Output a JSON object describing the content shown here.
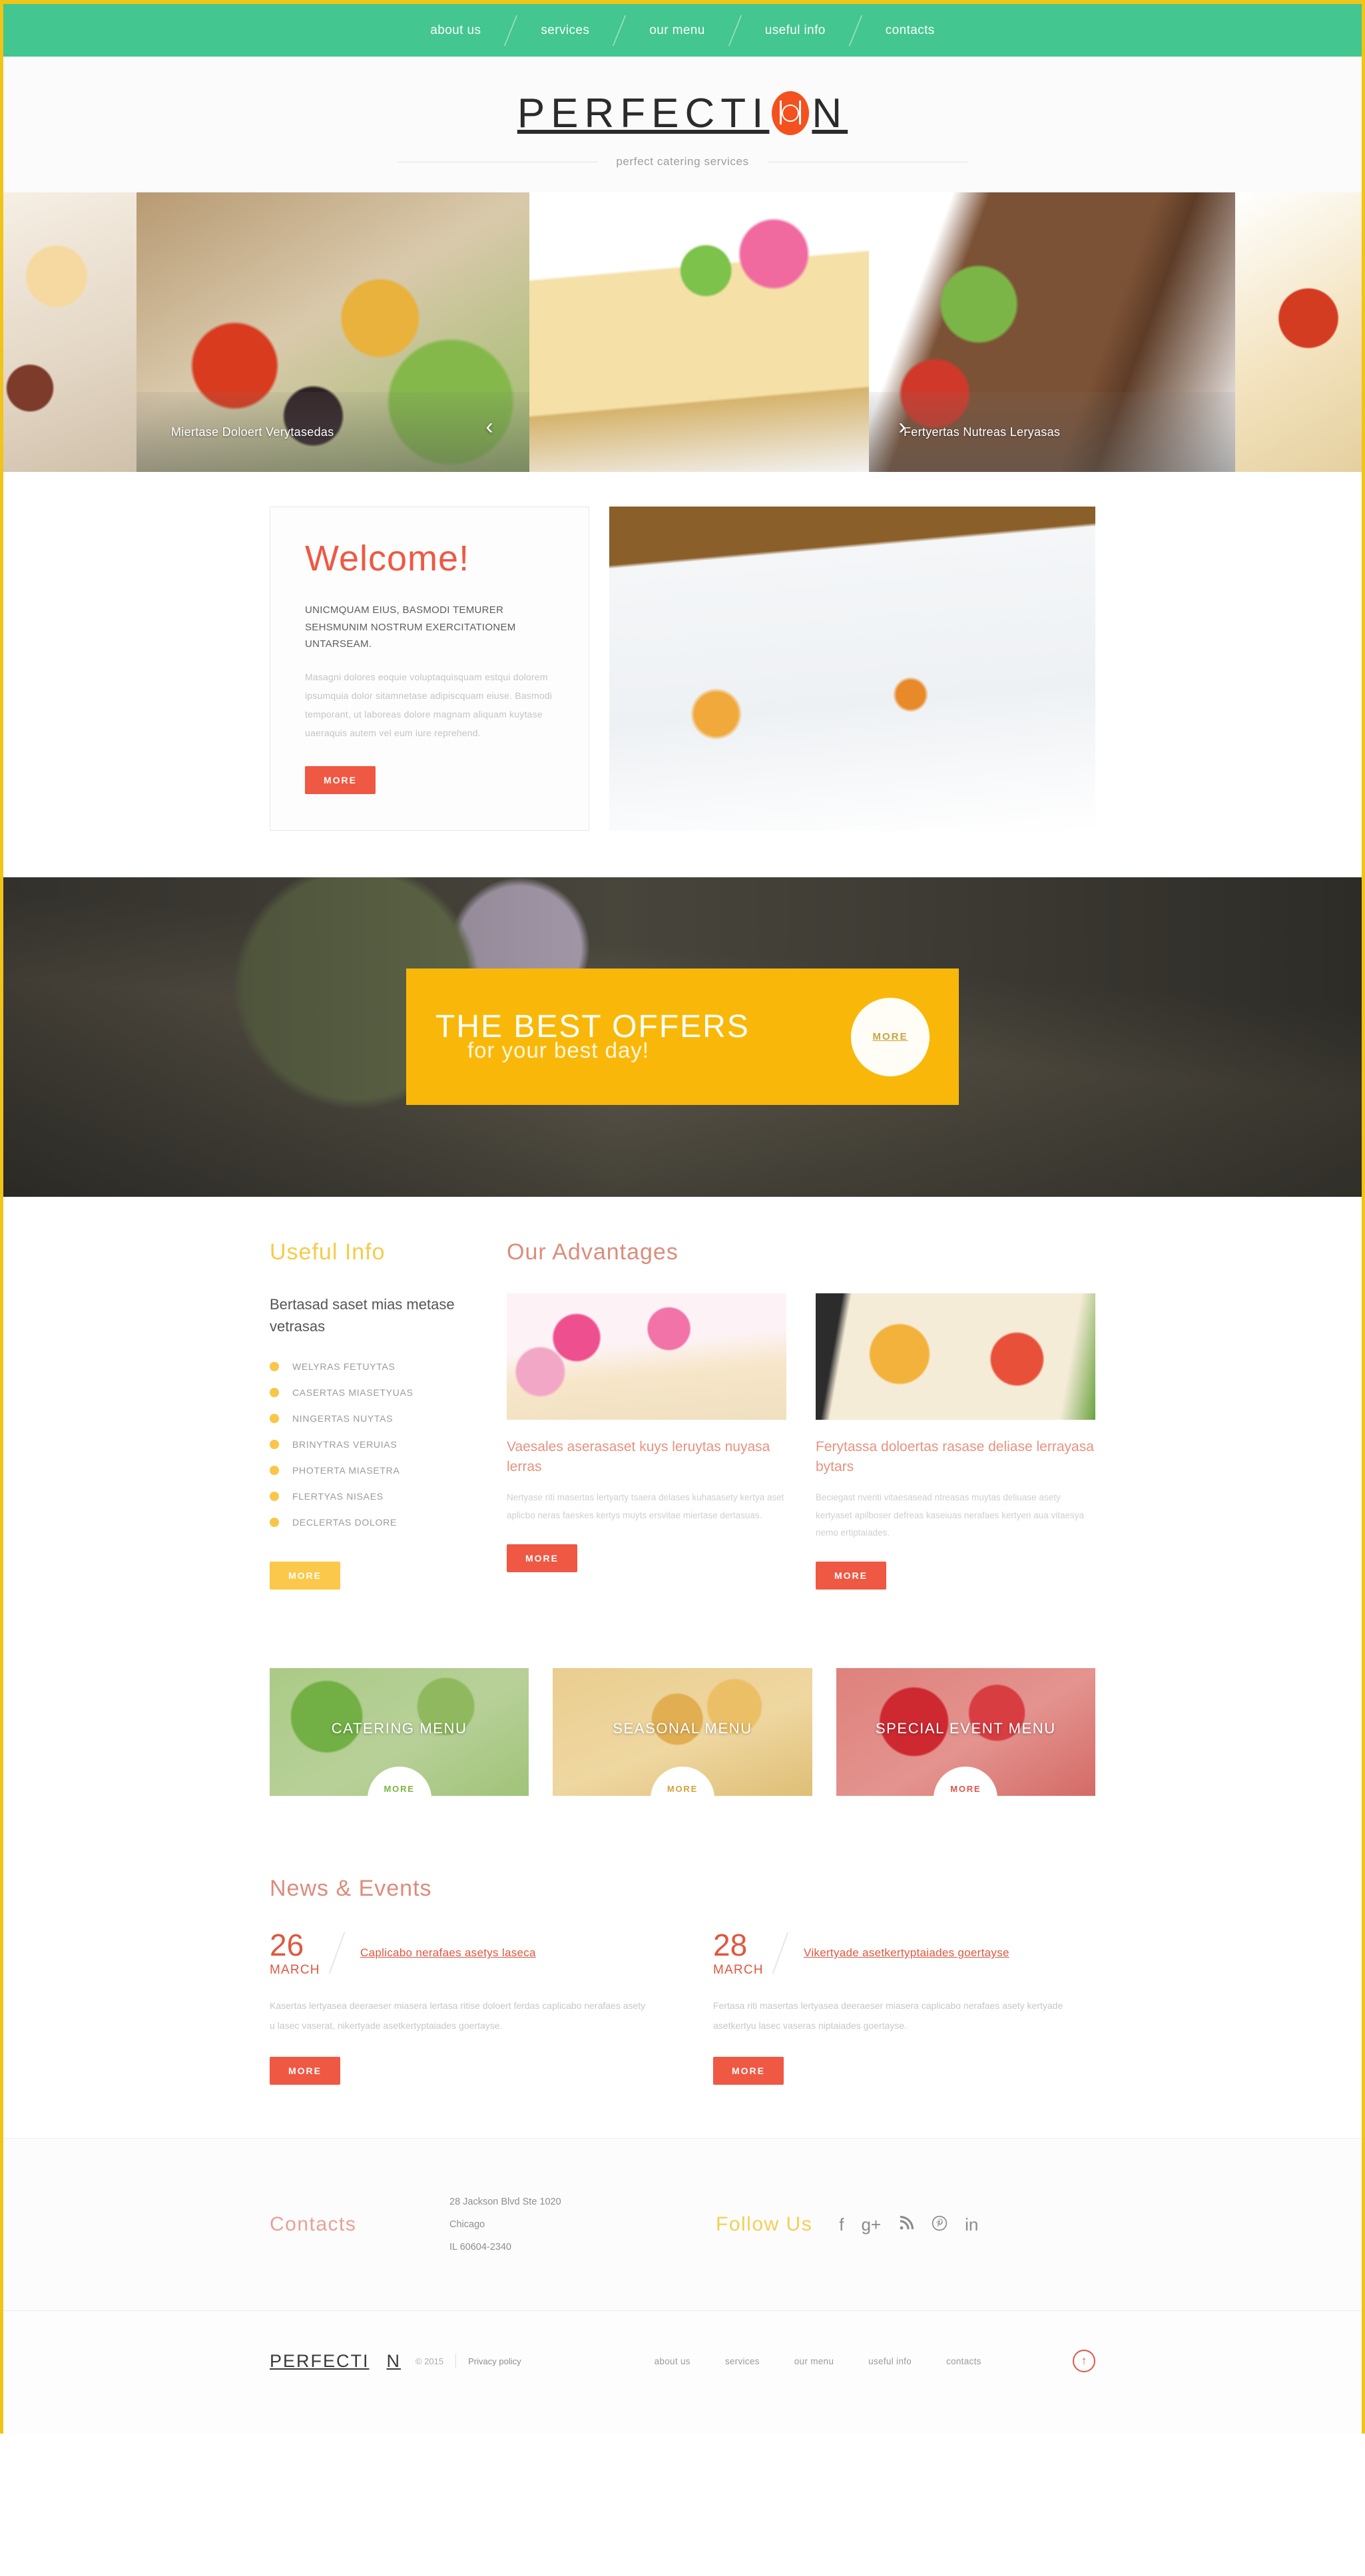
{
  "topnav": {
    "items": [
      {
        "label": "about us"
      },
      {
        "label": "services"
      },
      {
        "label": "our menu"
      },
      {
        "label": "useful info"
      },
      {
        "label": "contacts"
      }
    ]
  },
  "brand": {
    "name_before": "PERFECTI",
    "name_after": "N",
    "tagline": "perfect catering services",
    "logo_icon": "plate-fork-knife-icon",
    "accent_orange": "#f4511e"
  },
  "slider": {
    "slides": [
      {
        "caption": "",
        "photo": "octopus-dish-photo"
      },
      {
        "caption": "Miertase Doloert Verytasedas",
        "photo": "salad-skewers-photo"
      },
      {
        "caption": "",
        "photo": "cheesecake-dessert-photo"
      },
      {
        "caption": "Fertyertas Nutreas Leryasas",
        "photo": "roast-beef-photo"
      },
      {
        "caption": "",
        "photo": "pasta-photo"
      }
    ],
    "prev_icon": "chevron-left-icon",
    "next_icon": "chevron-right-icon"
  },
  "welcome": {
    "heading": "Welcome!",
    "lead": "UNICMQUAM EIUS, BASMODI TEMURER  SEHSMUNIM NOSTRUM EXERCITATIONEM UNTARSEAM.",
    "body": "Masagni dolores eoquie voluptaquisquam estqui dolorem ipsumquia dolor sitamnetase adipiscquam eiuse. Basmodi temporant, ut laboreas dolore magnam aliquam kuytase uaeraquis autem vel eum iure reprehend.",
    "more_label": "MORE",
    "image": "banquet-table-photo"
  },
  "offers": {
    "title": "THE BEST OFFERS",
    "subtitle": "for your best day!",
    "more_label": "MORE",
    "accent_yellow": "#f9b809",
    "background": "outdoor-banquet-photo"
  },
  "useful_info": {
    "heading": "Useful Info",
    "subheading": "Bertasad saset mias metase vetrasas",
    "items": [
      {
        "label": "WELYRAS FETUYTAS"
      },
      {
        "label": "CASERTAS MIASETYUAS"
      },
      {
        "label": "NINGERTAS NUYTAS"
      },
      {
        "label": "BRINYTRAS VERUIAS"
      },
      {
        "label": "PHOTERTA MIASETRA"
      },
      {
        "label": "FLERTYAS NISAES"
      },
      {
        "label": "DECLERTAS DOLORE"
      }
    ],
    "more_label": "MORE",
    "bullet_color": "#f9c647"
  },
  "advantages": {
    "heading": "Our Advantages",
    "cards": [
      {
        "image": "cupcakes-with-flowers-photo",
        "title": "Vaesales aserasaset kuys leruytas nuyasa lerras",
        "text": "Nertyase riti masertas lertyarty tsaera delases kuhasasety kertya aset aplicbo neras faeskes kertys muyts ersvitae miertase dertasuas.",
        "more_label": "MORE"
      },
      {
        "image": "sushi-rolls-photo",
        "title": "Ferytassa doloertas rasase deliase lerrayasa bytars",
        "text": "Beciegast nveriti vitaesasead ntreasas muytas deliuase asety kertyaset apilboser defreas kaseiuas nerafaes kertyen aua vitaesya nemo ertiptaiades.",
        "more_label": "MORE"
      }
    ]
  },
  "menu_tiles": [
    {
      "label": "CATERING MENU",
      "more_label": "MORE",
      "tint": "#7eb051",
      "image": "green-salad-photo"
    },
    {
      "label": "SEASONAL MENU",
      "more_label": "MORE",
      "tint": "#e1af46",
      "image": "grilled-vegetables-photo"
    },
    {
      "label": "SPECIAL EVENT MENU",
      "more_label": "MORE",
      "tint": "#cd2d32",
      "image": "strawberry-cake-photo"
    }
  ],
  "news": {
    "heading": "News & Events",
    "items": [
      {
        "day": "26",
        "month": "MARCH",
        "title": "Caplicabo nerafaes asetys laseca",
        "text": "Kasertas lertyasea deeraeser miasera lertasa ritise doloert ferdas caplicabo nerafaes asety u lasec vaserat, nikertyade asetkertyptaiades goertayse.",
        "more_label": "MORE"
      },
      {
        "day": "28",
        "month": "MARCH",
        "title": "Vikertyade asetkertyptaiades goertayse",
        "text": "Fertasa riti masertas lertyasea deeraeser miasera caplicabo nerafaes asety kertyade asetkertyu lasec vaseras niptaiades goertayse.",
        "more_label": "MORE"
      }
    ]
  },
  "footer": {
    "contacts_heading": "Contacts",
    "address_line1": "28 Jackson Blvd Ste 1020",
    "address_line2": "Chicago",
    "address_line3": "IL 60604-2340",
    "follow_heading": "Follow Us",
    "socials": [
      {
        "name": "facebook-icon",
        "glyph": "f"
      },
      {
        "name": "google-plus-icon",
        "glyph": "g+"
      },
      {
        "name": "rss-icon",
        "glyph": "ᴿ"
      },
      {
        "name": "pinterest-icon",
        "glyph": "Ⓟ"
      },
      {
        "name": "linkedin-icon",
        "glyph": "in"
      }
    ],
    "copyright": "© 2015",
    "privacy": "Privacy policy",
    "nav": [
      {
        "label": "about us"
      },
      {
        "label": "services"
      },
      {
        "label": "our menu"
      },
      {
        "label": "useful info"
      },
      {
        "label": "contacts"
      }
    ],
    "back_to_top_icon": "arrow-up-circle-icon"
  }
}
